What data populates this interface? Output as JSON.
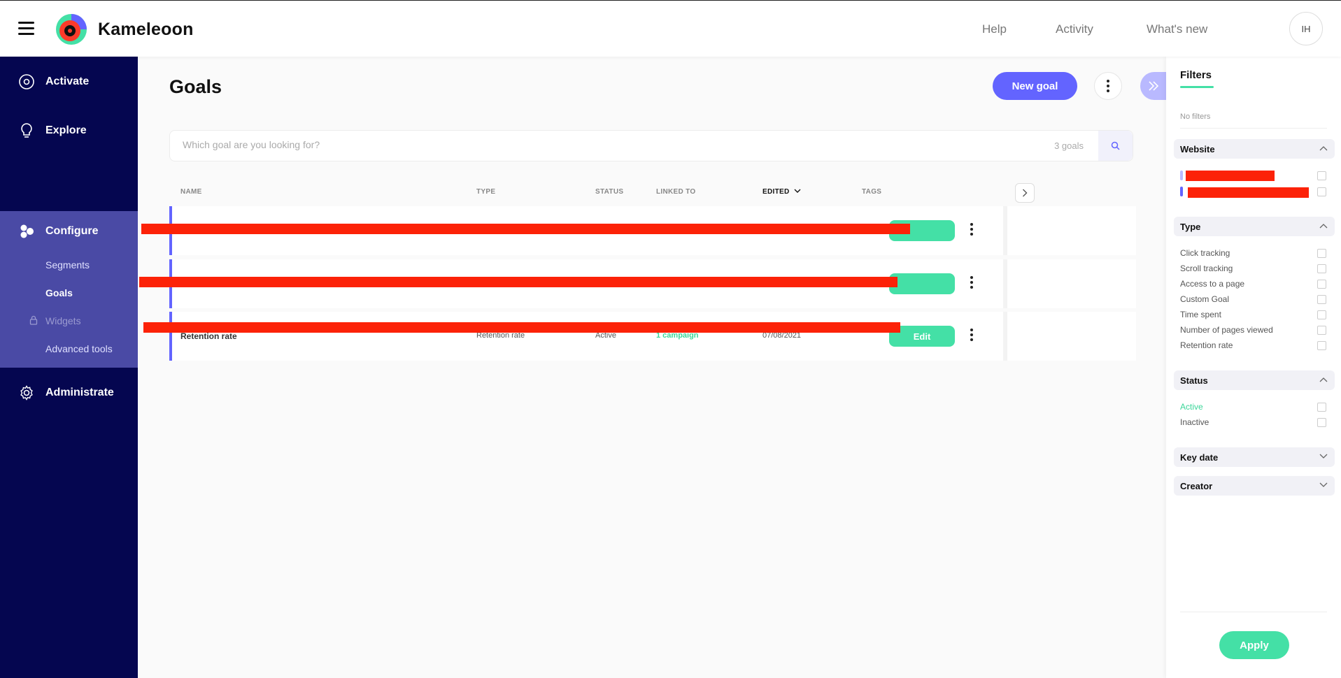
{
  "app": {
    "brand": "Kameleoon",
    "avatar_initials": "IH"
  },
  "topnav": {
    "help": "Help",
    "activity": "Activity",
    "whats_new": "What's new"
  },
  "sidebar": {
    "activate": "Activate",
    "explore": "Explore",
    "configure": "Configure",
    "sub": {
      "segments": "Segments",
      "goals": "Goals",
      "widgets": "Widgets",
      "advanced_tools": "Advanced tools"
    },
    "administrate": "Administrate"
  },
  "main": {
    "title": "Goals",
    "new_goal": "New goal",
    "search": {
      "placeholder": "Which goal are you looking for?",
      "count": "3 goals"
    },
    "columns": {
      "name": "NAME",
      "type": "TYPE",
      "status": "STATUS",
      "linked_to": "LINKED TO",
      "edited": "EDITED",
      "tags": "TAGS"
    },
    "rows": [
      {
        "name": "",
        "type": "",
        "status": "",
        "linked": "",
        "edited": "",
        "edit_label": ""
      },
      {
        "name": "",
        "type": "",
        "status": "",
        "linked": "",
        "edited": "",
        "edit_label": ""
      },
      {
        "name": "Retention rate",
        "type": "Retention rate",
        "status": "Active",
        "linked": "1 campaign",
        "edited": "07/08/2021",
        "edit_label": "Edit"
      }
    ]
  },
  "filters": {
    "title": "Filters",
    "no_filters": "No filters",
    "website": {
      "label": "Website"
    },
    "type": {
      "label": "Type",
      "options": [
        "Click tracking",
        "Scroll tracking",
        "Access to a page",
        "Custom Goal",
        "Time spent",
        "Number of pages viewed",
        "Retention rate"
      ]
    },
    "status": {
      "label": "Status",
      "active": "Active",
      "inactive": "Inactive"
    },
    "key_date": "Key date",
    "creator": "Creator",
    "apply": "Apply"
  },
  "colors": {
    "sidebar": "#050650",
    "configure": "#4a4aa5",
    "accent": "#6364ff",
    "green": "#44e0a6",
    "redaction": "#fc2208"
  }
}
